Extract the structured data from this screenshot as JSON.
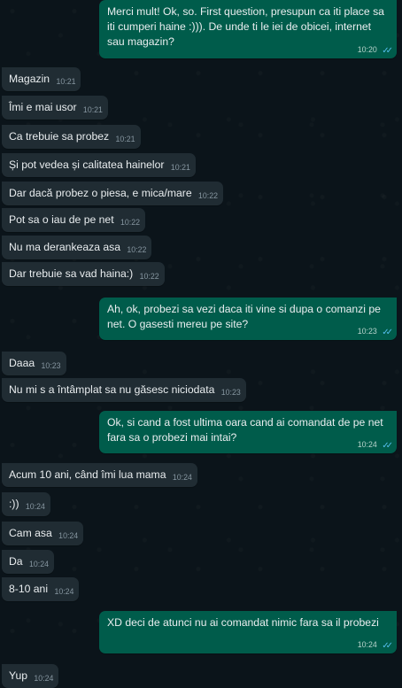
{
  "messages": [
    {
      "text": "Merci mult! Ok, so. First question, presupun ca iti place sa iti cumperi haine :))). De unde ti le iei de obicei, internet sau magazin?",
      "time": "10:20"
    },
    {
      "text": "Magazin",
      "time": "10:21"
    },
    {
      "text": "Îmi e mai usor",
      "time": "10:21"
    },
    {
      "text": "Ca trebuie sa probez",
      "time": "10:21"
    },
    {
      "text": "Și pot vedea și calitatea hainelor",
      "time": "10:21"
    },
    {
      "text": "Dar dacă probez o piesa, e mica/mare",
      "time": "10:22"
    },
    {
      "text": "Pot sa o iau de pe net",
      "time": "10:22"
    },
    {
      "text": "Nu ma derankeaza asa",
      "time": "10:22"
    },
    {
      "text": "Dar trebuie sa vad haina:)",
      "time": "10:22"
    },
    {
      "text": "Ah, ok, probezi sa vezi daca iti vine si dupa o comanzi pe net. O gasesti mereu pe site?",
      "time": "10:23"
    },
    {
      "text": "Daaa",
      "time": "10:23"
    },
    {
      "text": "Nu mi s a întâmplat sa nu găsesc niciodata",
      "time": "10:23"
    },
    {
      "text": "Ok, si cand a fost ultima oara cand ai comandat de pe net fara sa o probezi mai intai?",
      "time": "10:24"
    },
    {
      "text": "Acum 10 ani, când îmi lua mama",
      "time": "10:24"
    },
    {
      "text": ":))",
      "time": "10:24"
    },
    {
      "text": "Cam asa",
      "time": "10:24"
    },
    {
      "text": "Da",
      "time": "10:24"
    },
    {
      "text": "8-10 ani",
      "time": "10:24"
    },
    {
      "text": "XD deci de atunci nu ai comandat nimic fara sa il probezi",
      "time": "10:24"
    },
    {
      "text": "Yup",
      "time": "10:24"
    }
  ],
  "theme": {
    "background": "#0b141a",
    "incoming_bubble": "#202c33",
    "outgoing_bubble": "#005c4b",
    "message_text": "#e9edef",
    "timestamp": "#8696a0",
    "read_receipt": "#53bdeb"
  },
  "icons": {
    "read_receipt": "double-check-icon"
  }
}
